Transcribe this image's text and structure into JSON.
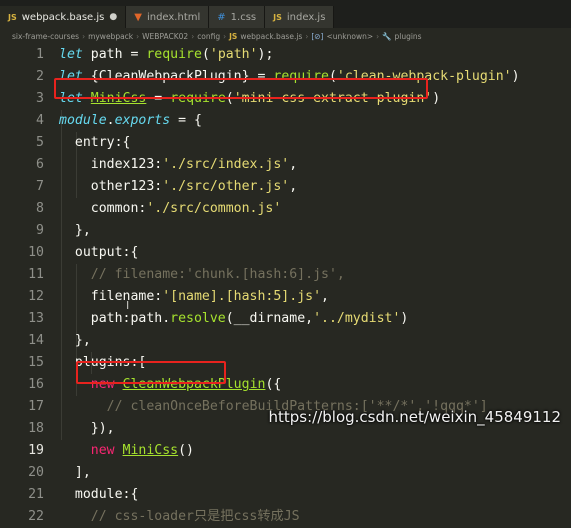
{
  "tabs": [
    {
      "icon": "JS",
      "label": "webpack.base.js",
      "status": "●",
      "active": true
    },
    {
      "icon": "html",
      "label": "index.html",
      "status": "",
      "active": false
    },
    {
      "icon": "css",
      "label": "1.css",
      "status": "",
      "active": false
    },
    {
      "icon": "JS",
      "label": "index.js",
      "status": "",
      "active": false
    }
  ],
  "breadcrumb": {
    "items": [
      "six-frame-courses",
      "mywebpack",
      "WEBPACK02",
      "config"
    ],
    "file_icon": "JS",
    "file": "webpack.base.js",
    "symbol1_icon": "[⊘]",
    "symbol1": "<unknown>",
    "symbol2": "plugins"
  },
  "lines": [
    {
      "n": "1",
      "tokens": [
        [
          "kw",
          "let"
        ],
        [
          "pun",
          " path = "
        ],
        [
          "fn",
          "require"
        ],
        [
          "pun",
          "("
        ],
        [
          "str",
          "'path'"
        ],
        [
          "pun",
          ");"
        ]
      ]
    },
    {
      "n": "2",
      "tokens": [
        [
          "kw",
          "let"
        ],
        [
          "pun",
          " {CleanWebpackPlugin} = "
        ],
        [
          "fn",
          "require"
        ],
        [
          "pun",
          "("
        ],
        [
          "str",
          "'clean-webpack-plugin'"
        ],
        [
          "pun",
          ")"
        ]
      ]
    },
    {
      "n": "3",
      "tokens": [
        [
          "kw",
          "let"
        ],
        [
          "pun",
          " "
        ],
        [
          "cls",
          "MiniCss"
        ],
        [
          "pun",
          " = "
        ],
        [
          "fn",
          "require"
        ],
        [
          "pun",
          "("
        ],
        [
          "str",
          "'mini-css-extract-plugin'"
        ],
        [
          "pun",
          ")"
        ]
      ]
    },
    {
      "n": "4",
      "tokens": [
        [
          "kw2",
          "module"
        ],
        [
          "pun",
          "."
        ],
        [
          "kw2",
          "exports"
        ],
        [
          "pun",
          " = {"
        ]
      ]
    },
    {
      "n": "5",
      "tokens": [
        [
          "pun",
          "  entry:{"
        ]
      ]
    },
    {
      "n": "6",
      "tokens": [
        [
          "pun",
          "    index123:"
        ],
        [
          "str",
          "'./src/index.js'"
        ],
        [
          "pun",
          ","
        ]
      ]
    },
    {
      "n": "7",
      "tokens": [
        [
          "pun",
          "    other123:"
        ],
        [
          "str",
          "'./src/other.js'"
        ],
        [
          "pun",
          ","
        ]
      ]
    },
    {
      "n": "8",
      "tokens": [
        [
          "pun",
          "    common:"
        ],
        [
          "str",
          "'./src/common.js'"
        ]
      ]
    },
    {
      "n": "9",
      "tokens": [
        [
          "pun",
          "  },"
        ]
      ]
    },
    {
      "n": "10",
      "tokens": [
        [
          "pun",
          "  output:{"
        ]
      ]
    },
    {
      "n": "11",
      "tokens": [
        [
          "cm",
          "    // filename:'chunk.[hash:6].js',"
        ]
      ]
    },
    {
      "n": "12",
      "tokens": [
        [
          "pun",
          "    filename:"
        ],
        [
          "str",
          "'[name].[hash:5].js'"
        ],
        [
          "pun",
          ","
        ]
      ]
    },
    {
      "n": "13",
      "tokens": [
        [
          "pun",
          "    path:path."
        ],
        [
          "fn",
          "resolve"
        ],
        [
          "pun",
          "(__dirname,"
        ],
        [
          "str",
          "'../mydist'"
        ],
        [
          "pun",
          ")"
        ]
      ]
    },
    {
      "n": "14",
      "tokens": [
        [
          "pun",
          "  },"
        ]
      ]
    },
    {
      "n": "15",
      "tokens": [
        [
          "pun",
          "  plugins:["
        ]
      ]
    },
    {
      "n": "16",
      "tokens": [
        [
          "nw",
          "    new"
        ],
        [
          "pun",
          " "
        ],
        [
          "cls",
          "CleanWebpackPlugin"
        ],
        [
          "pun",
          "({"
        ]
      ]
    },
    {
      "n": "17",
      "tokens": [
        [
          "cm",
          "      // cleanOnceBeforeBuildPatterns:['**/*','!qqq*']"
        ]
      ]
    },
    {
      "n": "18",
      "tokens": [
        [
          "pun",
          "    }),"
        ]
      ]
    },
    {
      "n": "19",
      "tokens": [
        [
          "nw",
          "    new"
        ],
        [
          "pun",
          " "
        ],
        [
          "cls",
          "MiniCss"
        ],
        [
          "pun",
          "()"
        ]
      ]
    },
    {
      "n": "20",
      "tokens": [
        [
          "pun",
          "  ],"
        ]
      ]
    },
    {
      "n": "21",
      "tokens": [
        [
          "pun",
          "  module:{"
        ]
      ]
    },
    {
      "n": "22",
      "tokens": [
        [
          "cm",
          "    // css-loader只是把css转成JS"
        ]
      ]
    }
  ],
  "watermark": "https://blog.csdn.net/weixin_45849112"
}
